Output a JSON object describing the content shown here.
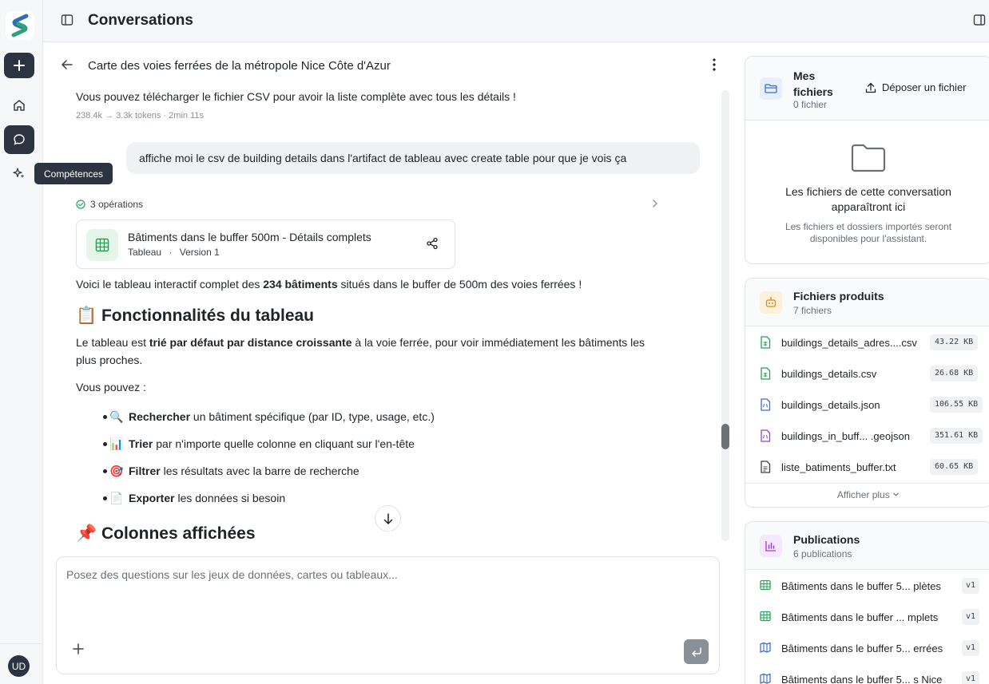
{
  "app": {
    "title": "Conversations"
  },
  "rail": {
    "user_initials": "UD",
    "tooltip": "Compétences"
  },
  "conversation": {
    "title": "Carte des voies ferrées de la métropole Nice Côte d'Azur",
    "prev_message": "Vous pouvez télécharger le fichier CSV pour avoir la liste complète avec tous les détails !",
    "prev_meta": "238.4k → 3.3k tokens · 2min 11s",
    "user_message": "affiche moi le csv de building details dans l'artifact de tableau avec create table pour que je vois ça",
    "operations": "3 opérations",
    "artifact": {
      "name": "Bâtiments dans le buffer 500m - Détails complets",
      "type": "Tableau",
      "version": "Version 1"
    },
    "intro_pre": "Voici le tableau interactif complet des ",
    "intro_bold": "234 bâtiments",
    "intro_post": " situés dans le buffer de 500m des voies ferrées !",
    "h_features": "📋 Fonctionnalités du tableau",
    "sorted_pre": "Le tableau est ",
    "sorted_bold": "trié par défaut par distance croissante",
    "sorted_post": " à la voie ferrée, pour voir immédiatement les bâtiments les plus proches.",
    "you_can": "Vous pouvez :",
    "bullets": [
      {
        "emoji": "🔍",
        "bold": "Rechercher",
        "text": " un bâtiment spécifique (par ID, type, usage, etc.)"
      },
      {
        "emoji": "📊",
        "bold": "Trier",
        "text": " par n'importe quelle colonne en cliquant sur l'en-tête"
      },
      {
        "emoji": "🎯",
        "bold": "Filtrer",
        "text": " les résultats avec la barre de recherche"
      },
      {
        "emoji": "📄",
        "bold": "Exporter",
        "text": " les données si besoin"
      }
    ],
    "h_columns": "📌 Colonnes affichées"
  },
  "composer": {
    "placeholder": "Posez des questions sur les jeux de données, cartes ou tableaux..."
  },
  "my_files": {
    "title": "Mes fichiers",
    "count": "0 fichier",
    "upload_label": "Déposer un fichier",
    "empty_title": "Les fichiers de cette conversation apparaîtront ici",
    "empty_sub": "Les fichiers et dossiers importés seront disponibles pour l'assistant."
  },
  "produced": {
    "title": "Fichiers produits",
    "count": "7 fichiers",
    "files": [
      {
        "name": "buildings_details_adres....csv",
        "size": "43.22 KB",
        "kind": "csv"
      },
      {
        "name": "buildings_details.csv",
        "size": "26.68 KB",
        "kind": "csv"
      },
      {
        "name": "buildings_details.json",
        "size": "106.55 KB",
        "kind": "json"
      },
      {
        "name": "buildings_in_buff... .geojson",
        "size": "351.61 KB",
        "kind": "geojson"
      },
      {
        "name": "liste_batiments_buffer.txt",
        "size": "60.65 KB",
        "kind": "txt"
      }
    ],
    "show_more": "Afficher plus"
  },
  "publications": {
    "title": "Publications",
    "count": "6 publications",
    "items": [
      {
        "name": "Bâtiments dans le buffer 5... plètes",
        "version": "v1",
        "kind": "table"
      },
      {
        "name": "Bâtiments dans le buffer ... mplets",
        "version": "v1",
        "kind": "table"
      },
      {
        "name": "Bâtiments dans le buffer 5... errées",
        "version": "v1",
        "kind": "map"
      },
      {
        "name": "Bâtiments dans le buffer 5... s Nice",
        "version": "v1",
        "kind": "map"
      }
    ]
  },
  "colors": {
    "accent_dark": "#2b3440",
    "green": "#22a356",
    "blue": "#3b6fd1",
    "purple": "#9b3fcf",
    "orange": "#d98a1f"
  }
}
